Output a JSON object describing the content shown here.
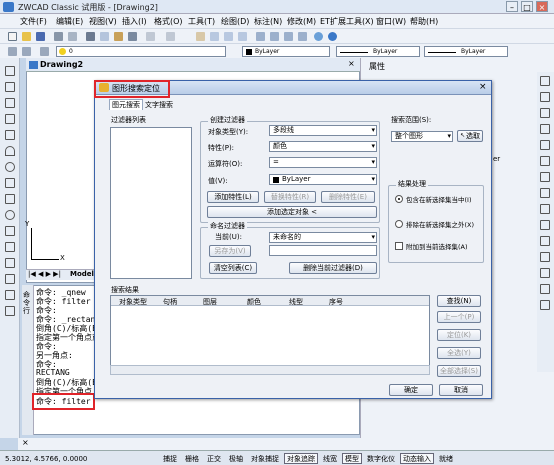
{
  "app": {
    "title": "ZWCAD Classic 试用版 - [Drawing2]"
  },
  "menu": [
    "文件(F)",
    "编辑(E)",
    "视图(V)",
    "插入(I)",
    "格式(O)",
    "工具(T)",
    "绘图(D)",
    "标注(N)",
    "修改(M)",
    "ET扩展工具(X)",
    "窗口(W)",
    "帮助(H)"
  ],
  "toolbar": {
    "layer_value": "0",
    "color_value": "ByLayer",
    "linetype_value": "ByLayer",
    "lineweight_value": "ByLayer"
  },
  "drawing": {
    "tab": "Drawing2",
    "layout_tab": "Model",
    "axis_x": "X",
    "axis_y": "Y"
  },
  "props": {
    "title": "属性",
    "row_label": "er"
  },
  "command": {
    "side_label": "命令行",
    "lines": [
      "命令: _qnew",
      "命令: filter",
      "命令:",
      "命令: _rectang",
      "倒角(C)/标高(E)",
      "指定第一个角点或",
      "命令:",
      "另一角点:",
      "命令:",
      "RECTANG",
      "倒角(C)/标高(E)",
      "指定第一个角点",
      "命令: filter"
    ]
  },
  "status": {
    "coords": "5.3012, 4.5766, 0.0000",
    "buttons": [
      "捕捉",
      "栅格",
      "正交",
      "极轴",
      "对象捕捉",
      "对象追踪",
      "线宽",
      "模型",
      "数字化仪",
      "动态输入",
      "就绪"
    ]
  },
  "dialog": {
    "title": "图形搜索定位",
    "tabs": [
      "图元搜索",
      "文字搜索"
    ],
    "filter_list_label": "过滤器列表",
    "create_filter_label": "创建过滤器",
    "object_type_label": "对象类型(Y):",
    "object_type_value": "多段线",
    "property_label": "特性(P):",
    "property_value": "颜色",
    "operator_label": "运算符(O):",
    "operator_value": "=",
    "value_label": "值(V):",
    "value_value": "ByLayer",
    "add_property_btn": "添加特性(L)",
    "replace_property_btn": "替换特性(R)",
    "delete_property_btn": "删除特性(E)",
    "add_selected_btn": "添加选定对象 <",
    "named_filter_label": "命名过滤器",
    "current_label": "当前(U):",
    "current_value": "未命名的",
    "save_as_btn": "另存为(V)",
    "clear_list_btn": "清空列表(C)",
    "delete_filter_btn": "删除当前过滤器(D)",
    "search_range_label": "搜索范围(S):",
    "search_range_value": "整个图形",
    "select_btn": "选取",
    "result_process_label": "结果处理",
    "radio_include": "包含在新选择集当中(I)",
    "radio_exclude": "排除在新选择集之外(X)",
    "chk_append": "附加到当前选择集(A)",
    "results_label": "搜索结果",
    "columns": [
      "对象类型",
      "句柄",
      "图层",
      "颜色",
      "线型",
      "序号"
    ],
    "find_btn": "查找(N)",
    "prev_btn": "上一个(P)",
    "locate_btn": "定位(K)",
    "select_all_btn": "全选(Y)",
    "select_all_result_btn": "全部选择(S)",
    "ok_btn": "确定",
    "cancel_btn": "取消"
  }
}
